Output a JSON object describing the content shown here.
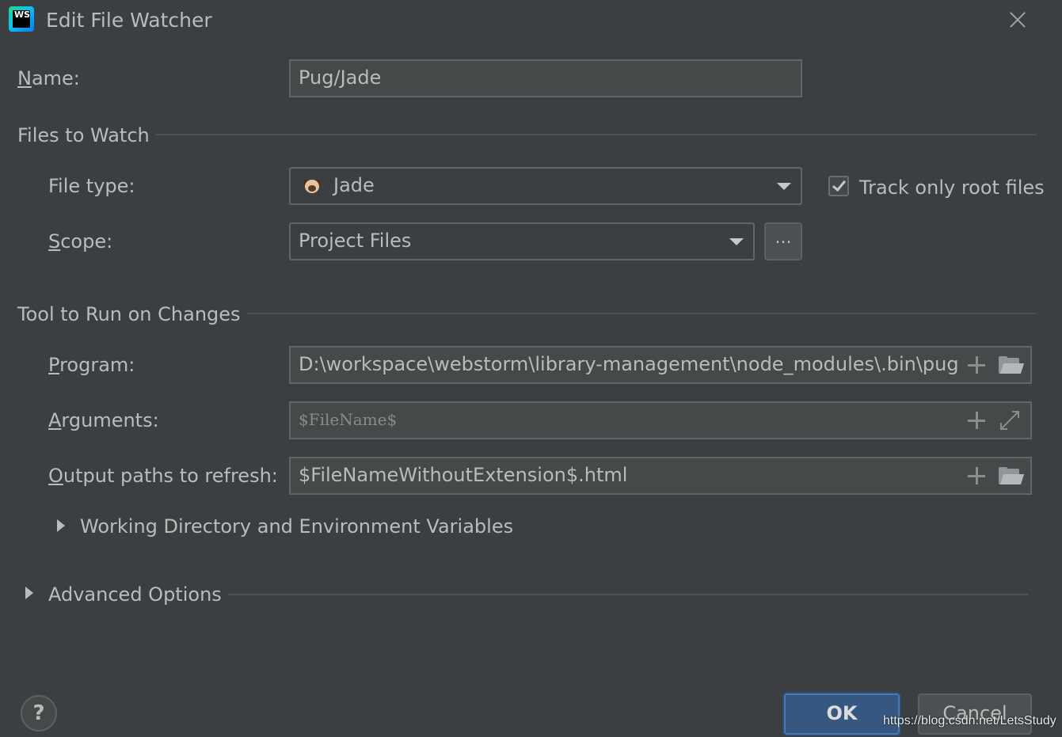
{
  "window": {
    "title": "Edit File Watcher",
    "app_icon": "webstorm-icon",
    "app_icon_text": "WS"
  },
  "name": {
    "label": "Name:",
    "value": "Pug/Jade"
  },
  "files_to_watch": {
    "section_title": "Files to Watch",
    "file_type_label": "File type:",
    "file_type_value": "Jade",
    "file_type_icon": "pug-icon",
    "track_root_label": "Track only root files",
    "track_root_checked": true,
    "scope_label": "Scope:",
    "scope_value": "Project Files",
    "scope_browse_label": "..."
  },
  "tool": {
    "section_title": "Tool to Run on Changes",
    "program_label": "Program:",
    "program_value": "D:\\workspace\\webstorm\\library-management\\node_modules\\.bin\\pug",
    "arguments_label": "Arguments:",
    "arguments_value": "$FileName$",
    "output_label": "Output paths to refresh:",
    "output_value": "$FileNameWithoutExtension$.html",
    "working_dir_label": "Working Directory and Environment Variables"
  },
  "advanced": {
    "label": "Advanced Options"
  },
  "footer": {
    "help_label": "?",
    "ok_label": "OK",
    "cancel_label": "Cancel",
    "watermark": "https://blog.csdn.net/LetsStudy"
  },
  "colors": {
    "background": "#3c3f41",
    "text": "#bbbbbb",
    "accent": "#365880"
  }
}
